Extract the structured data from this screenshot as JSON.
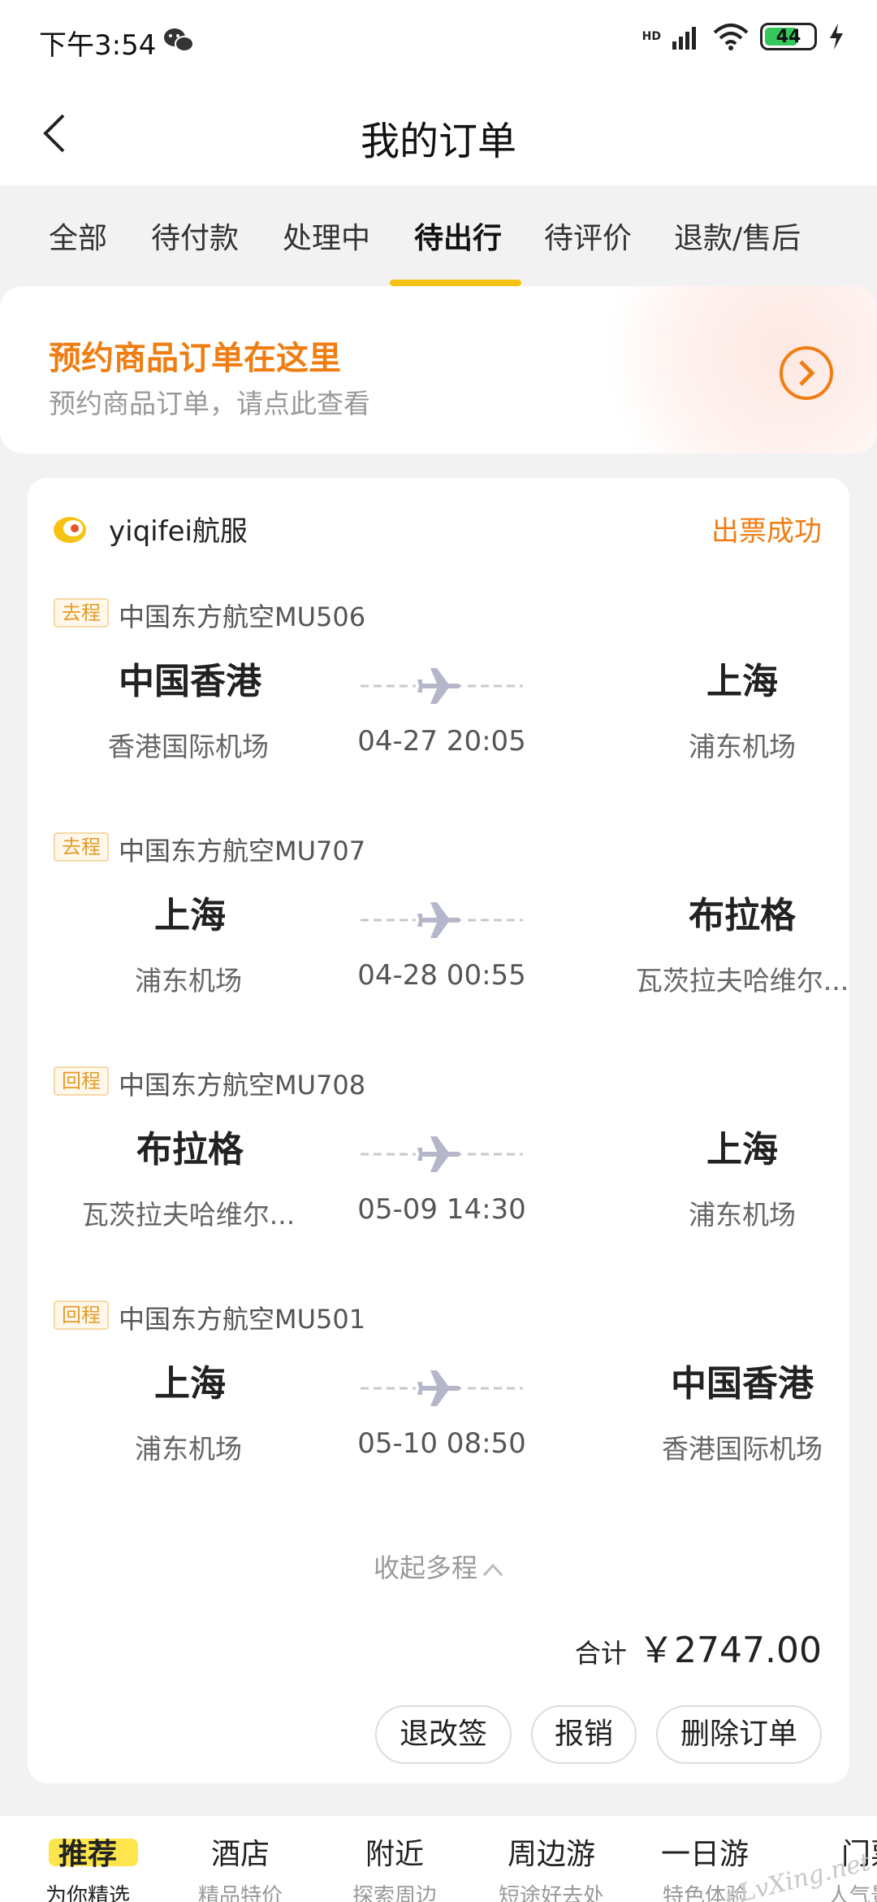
{
  "status_bar": {
    "time": "下午3:54",
    "network": "HD",
    "battery": "44"
  },
  "header": {
    "title": "我的订单"
  },
  "tabs": [
    {
      "label": "全部"
    },
    {
      "label": "待付款"
    },
    {
      "label": "处理中"
    },
    {
      "label": "待出行",
      "active": true
    },
    {
      "label": "待评价"
    },
    {
      "label": "退款/售后"
    }
  ],
  "promo": {
    "title": "预约商品订单在这里",
    "subtitle": "预约商品订单，请点此查看"
  },
  "order": {
    "agency": "yiqifei航服",
    "status": "出票成功",
    "legs": [
      {
        "tag": "去程",
        "flight": "中国东方航空MU506",
        "from_city": "中国香港",
        "from_airport": "香港国际机场",
        "datetime": "04-27 20:05",
        "to_city": "上海",
        "to_airport": "浦东机场"
      },
      {
        "tag": "去程",
        "flight": "中国东方航空MU707",
        "from_city": "上海",
        "from_airport": "浦东机场",
        "datetime": "04-28 00:55",
        "to_city": "布拉格",
        "to_airport": "瓦茨拉夫哈维尔..."
      },
      {
        "tag": "回程",
        "flight": "中国东方航空MU708",
        "from_city": "布拉格",
        "from_airport": "瓦茨拉夫哈维尔...",
        "datetime": "05-09 14:30",
        "to_city": "上海",
        "to_airport": "浦东机场"
      },
      {
        "tag": "回程",
        "flight": "中国东方航空MU501",
        "from_city": "上海",
        "from_airport": "浦东机场",
        "datetime": "05-10 08:50",
        "to_city": "中国香港",
        "to_airport": "香港国际机场"
      }
    ],
    "collapse_label": "收起多程",
    "total_label": "合计",
    "total_amount": "￥2747.00",
    "actions": {
      "change": "退改签",
      "reimburse": "报销",
      "delete": "删除订单"
    }
  },
  "bottom_nav": [
    {
      "main": "推荐",
      "sub": "为你精选",
      "active": true
    },
    {
      "main": "酒店",
      "sub": "精品特价"
    },
    {
      "main": "附近",
      "sub": "探索周边"
    },
    {
      "main": "周边游",
      "sub": "短途好去处"
    },
    {
      "main": "一日游",
      "sub": "特色体验"
    },
    {
      "main": "门票",
      "sub": "人气景点"
    }
  ],
  "watermark": "eLvXing.net",
  "colors": {
    "accent_yellow": "#f7c312",
    "accent_orange": "#f07d12"
  },
  "icons": [
    "wechat-icon",
    "signal-icon",
    "wifi-icon",
    "battery-icon",
    "charging-icon",
    "back-arrow-icon",
    "chevron-right-circle-icon",
    "agency-logo-icon",
    "airplane-icon",
    "chevron-up-icon"
  ]
}
